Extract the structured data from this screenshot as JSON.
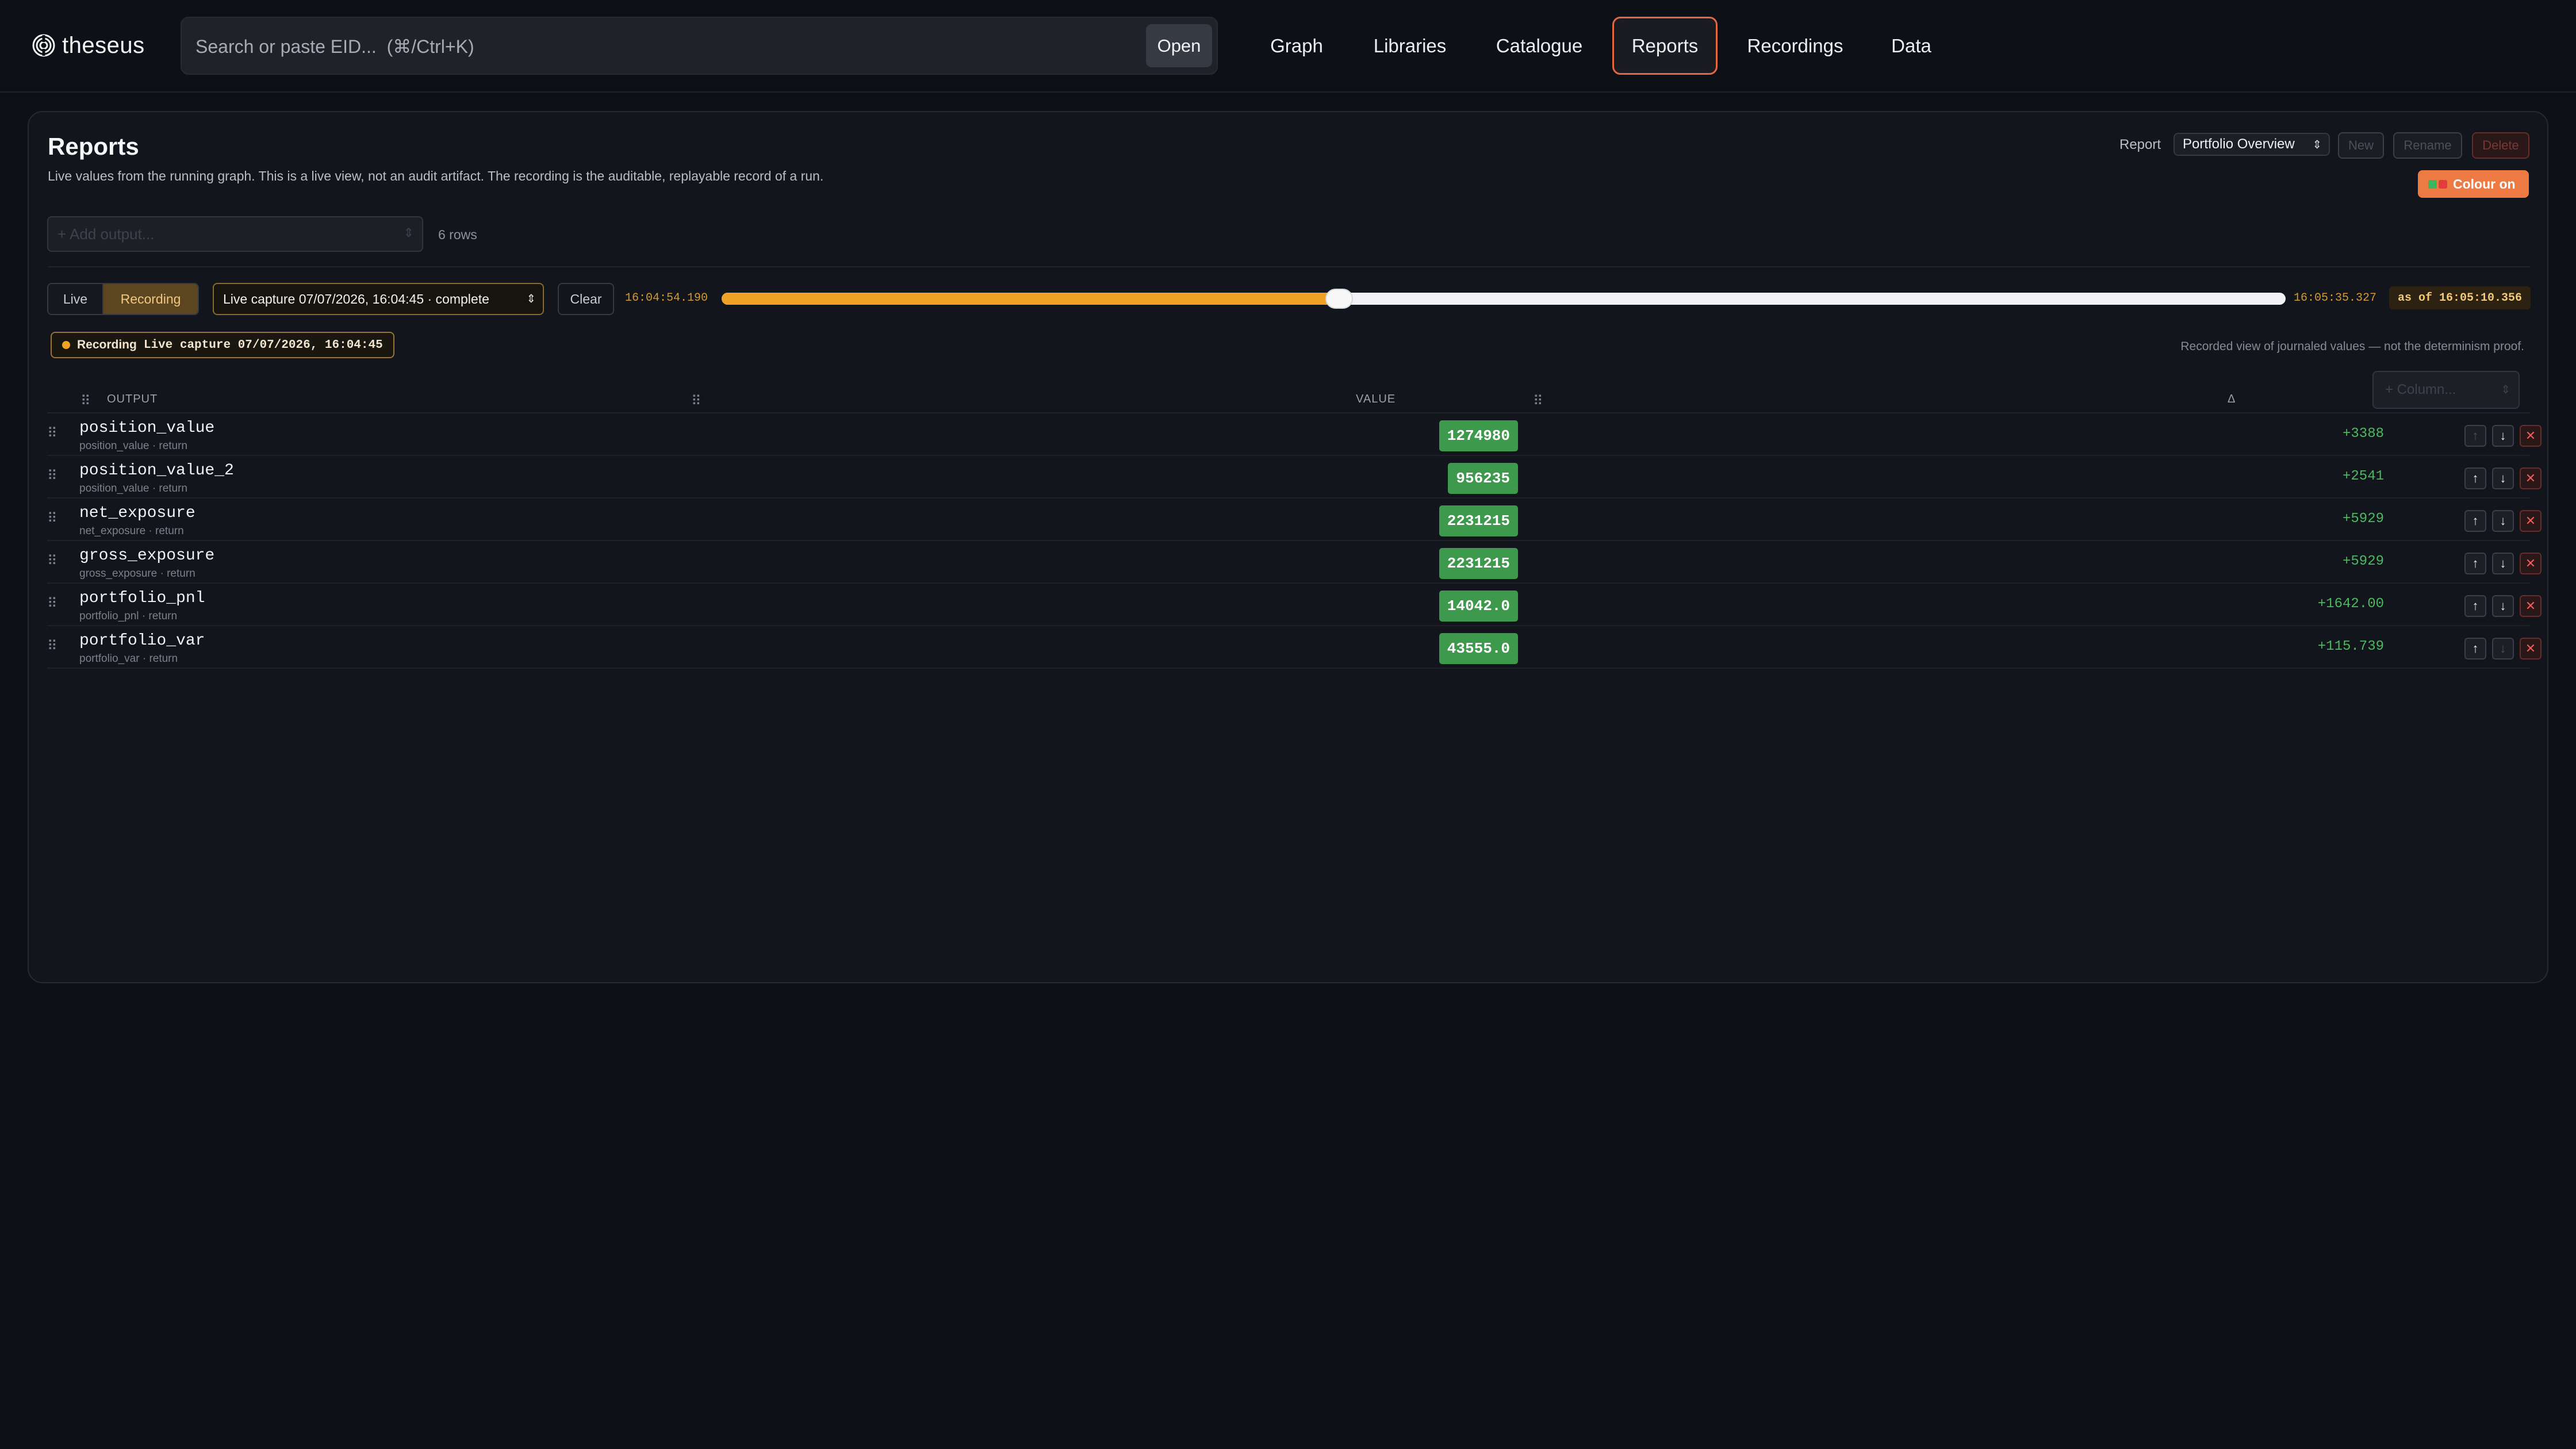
{
  "header": {
    "logo_text": "theseus",
    "search_placeholder": "Search or paste EID...  (⌘/Ctrl+K)",
    "open_label": "Open",
    "nav": [
      {
        "label": "Graph",
        "active": false
      },
      {
        "label": "Libraries",
        "active": false
      },
      {
        "label": "Catalogue",
        "active": false
      },
      {
        "label": "Reports",
        "active": true
      },
      {
        "label": "Recordings",
        "active": false
      },
      {
        "label": "Data",
        "active": false
      }
    ]
  },
  "reports": {
    "title": "Reports",
    "description": "Live values from the running graph. This is a live view, not an audit artifact. The recording is the auditable, replayable record of a run.",
    "report_label": "Report",
    "report_selected": "Portfolio Overview",
    "new_label": "New",
    "rename_label": "Rename",
    "delete_label": "Delete",
    "colour_label": "Colour on",
    "add_output_placeholder": "+ Add output...",
    "rows_count": "6 rows"
  },
  "playback": {
    "live_label": "Live",
    "recording_label": "Recording",
    "mode": "Recording",
    "capture_selected": "Live capture 07/07/2026, 16:04:45 · complete",
    "clear_label": "Clear",
    "start_time": "16:04:54.190",
    "end_time": "16:05:35.327",
    "progress": 0.395,
    "as_of": "as of 16:05:10.356",
    "badge_label": "Recording",
    "badge_capture": "Live capture 07/07/2026, 16:04:45",
    "note": "Recorded view of journaled values — not the determinism proof."
  },
  "table": {
    "columns": {
      "output": "OUTPUT",
      "value": "VALUE",
      "delta": "Δ"
    },
    "column_button": "+ Column...",
    "rows": [
      {
        "name": "position_value",
        "sub": "position_value · return",
        "value": "1274980",
        "delta": "+3388",
        "up_enabled": false,
        "down_enabled": true
      },
      {
        "name": "position_value_2",
        "sub": "position_value · return",
        "value": "956235",
        "delta": "+2541",
        "up_enabled": true,
        "down_enabled": true
      },
      {
        "name": "net_exposure",
        "sub": "net_exposure · return",
        "value": "2231215",
        "delta": "+5929",
        "up_enabled": true,
        "down_enabled": true
      },
      {
        "name": "gross_exposure",
        "sub": "gross_exposure · return",
        "value": "2231215",
        "delta": "+5929",
        "up_enabled": true,
        "down_enabled": true
      },
      {
        "name": "portfolio_pnl",
        "sub": "portfolio_pnl · return",
        "value": "14042.0",
        "delta": "+1642.00",
        "up_enabled": true,
        "down_enabled": true
      },
      {
        "name": "portfolio_var",
        "sub": "portfolio_var · return",
        "value": "43555.0",
        "delta": "+115.739",
        "up_enabled": true,
        "down_enabled": false
      }
    ]
  },
  "colors": {
    "accent": "#e2683f",
    "recording": "#f0a227",
    "value_bg": "#3d9a4c",
    "delta": "#4cb960",
    "danger": "#f15b5b"
  }
}
